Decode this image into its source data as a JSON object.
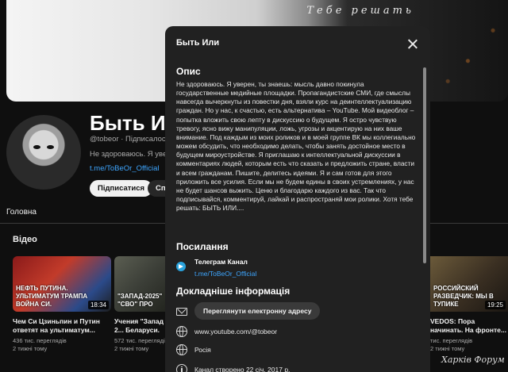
{
  "banner": {
    "text": "Тебе решать"
  },
  "channel": {
    "name": "Быть Или",
    "meta": "@tobeor · Підписалося 7",
    "desc": "Не здоровaюсь. Я уверен, ти",
    "link": "t.me/ToBeOr_Official",
    "subscribe_label": "Підписатися",
    "join_label": "Спо"
  },
  "tabs": {
    "home": "Головна"
  },
  "videos_section": {
    "title": "Відео"
  },
  "videos": [
    {
      "thumb_caption": "НЕФТЬ ПУТИНА. УЛЬТИМАТУМ ТРАМПА ВОЙНА СИ.",
      "duration": "18:34",
      "title": "Чем Си Цзиньпин и Путин ответят на ультиматум...",
      "views": "436 тис. переглядів",
      "age": "2 тижні тому"
    },
    {
      "thumb_caption": "\"ЗАПАД-2025\" \"СВО\" ПРО",
      "duration": "",
      "title": "Учения \"Запад 2... Беларуси. Почем...",
      "views": "572 тис. переглядів",
      "age": "2 тижні тому"
    },
    {
      "thumb_caption": "РОССИЙСКИЙ РАЗВЕДЧИК: МЫ В ТУПИКЕ",
      "duration": "19:25",
      "title": "VEDOS: Пора начинать. На фронте...",
      "views": "тис. переглядів",
      "age": "2 тижні тому"
    }
  ],
  "dialog": {
    "title": "Быть Или",
    "about_heading": "Опис",
    "about_text": "Не здоровaюсь. Я уверен, ты знаешь: мысль давно покинула государственные медийные площадки. Пропагандистские СМИ, где смыслы навсегда вычеркнуты из повестки дня, взяли курс на деинтеллектуализацию граждан. Но у нас, к счастью, есть альтернатива – YouTube. Мой видеоблог – попытка вложить свою лепту в дискуссию о будущем. Я остро чувствую тревогу, ясно вижу манипуляции, ложь, угрозы и акцентирую на них ваше внимание. Под каждым из моих роликов и в моей группе ВК мы коллегиально можем обсудить, что необходимо делать, чтобы занять достойное место в будущем мироустройстве. Я приглашаю к интеллектуальной дискуссии в комментариях людей, которым есть что сказать и предложить стране, власти и всем гражданам. Пишите, делитесь идеями. Я и сам готов для этого приложить все усилия. Если мы не будем едины в своих устремлениях, у нас не будет шансов выжить. Ценю и благодарю каждого из вас. Так что подписывайся, комментируй, лайкай и распространяй мои ролики. Хотя тебе решать: БЫТЬ ИЛИ....",
    "links_heading": "Посилання",
    "telegram_name": "Телеграм Канал",
    "telegram_link": "t.me/ToBeOr_Official",
    "details_heading": "Докладніше інформація",
    "email_button": "Переглянути електронну адресу",
    "website": "www.youtube.com/@tobeor",
    "country": "Росія",
    "joined": "Канал створено 22 січ. 2017 р."
  },
  "watermark": "Харків Форум"
}
